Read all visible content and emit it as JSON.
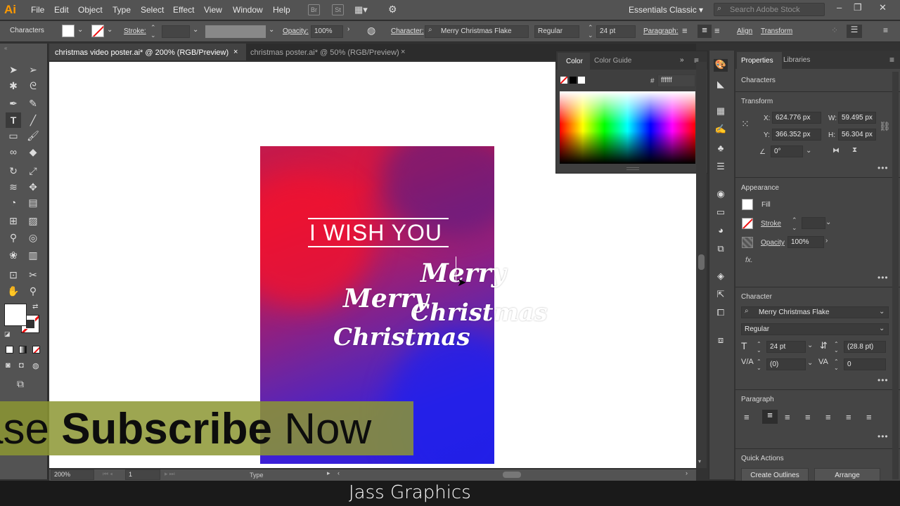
{
  "menubar": {
    "logo": "Ai",
    "items": [
      "File",
      "Edit",
      "Object",
      "Type",
      "Select",
      "Effect",
      "View",
      "Window",
      "Help"
    ],
    "br": "Br",
    "st": "St",
    "workspace": "Essentials Classic",
    "search_placeholder": "Search Adobe Stock"
  },
  "control": {
    "characters_label": "Characters",
    "stroke_label": "Stroke:",
    "opacity_label": "Opacity:",
    "opacity_value": "100%",
    "character_label": "Character:",
    "font_name": "Merry Christmas Flake",
    "font_style": "Regular",
    "font_size": "24 pt",
    "paragraph_label": "Paragraph:",
    "align_label": "Align",
    "transform_label": "Transform"
  },
  "tabs": [
    {
      "label": "christmas video poster.ai* @ 200% (RGB/Preview)",
      "close": "×"
    },
    {
      "label": "christmas poster.ai* @ 50% (RGB/Preview)",
      "close": "×"
    }
  ],
  "poster": {
    "heading": "I WISH YOU",
    "merry1": "Merry",
    "christmas1": "Christmas",
    "merry2": "Merry",
    "christmas2": "Christmas"
  },
  "overlay": {
    "subscribe_pre": "ase ",
    "subscribe_bold": "Subscribe",
    "subscribe_post": " Now",
    "brand": "Jass Graphics"
  },
  "status": {
    "zoom": "200%",
    "page": "1",
    "mode": "Type"
  },
  "color_panel": {
    "tab_color": "Color",
    "tab_guide": "Color Guide",
    "hash": "#",
    "hex_value": "ffffff"
  },
  "properties": {
    "tab_properties": "Properties",
    "tab_libraries": "Libraries",
    "selection": "Characters",
    "transform_title": "Transform",
    "x_label": "X:",
    "x_value": "624.776 px",
    "y_label": "Y:",
    "y_value": "366.352 px",
    "w_label": "W:",
    "w_value": "59.495 px",
    "h_label": "H:",
    "h_value": "56.304 px",
    "angle_value": "0°",
    "appearance_title": "Appearance",
    "fill_label": "Fill",
    "stroke_label": "Stroke",
    "opacity_label": "Opacity",
    "opacity_value": "100%",
    "fx_label": "fx.",
    "character_title": "Character",
    "font_name": "Merry Christmas Flake",
    "font_style": "Regular",
    "font_size": "24 pt",
    "leading": "(28.8 pt)",
    "kerning": "(0)",
    "tracking": "0",
    "paragraph_title": "Paragraph",
    "quick_actions_title": "Quick Actions",
    "create_outlines": "Create Outlines",
    "arrange": "Arrange",
    "more": "•••"
  }
}
